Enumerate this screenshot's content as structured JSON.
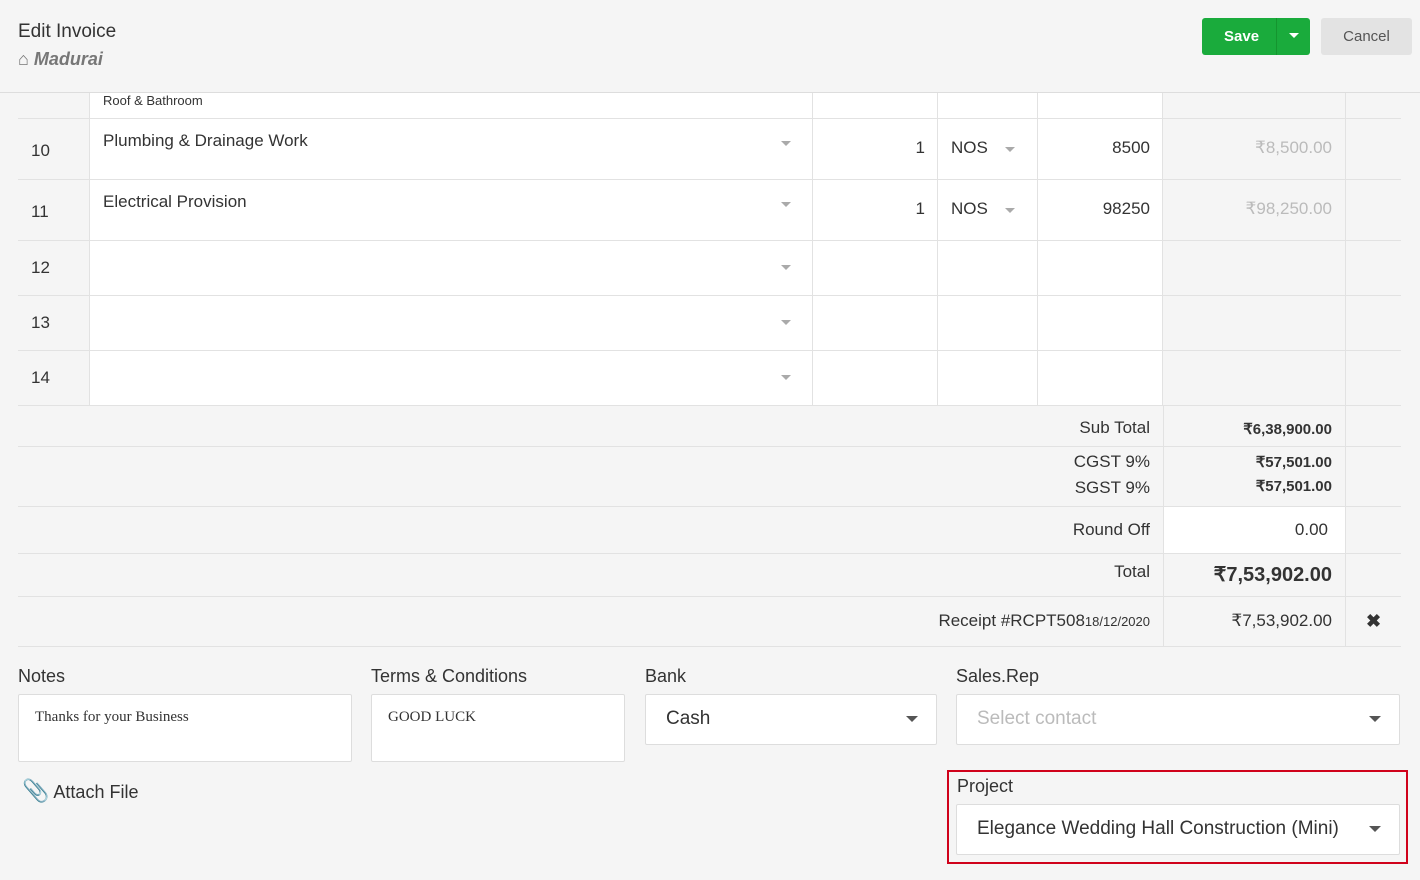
{
  "header": {
    "title": "Edit Invoice",
    "location": "Madurai",
    "save_label": "Save",
    "cancel_label": "Cancel"
  },
  "rows": [
    {
      "num": "",
      "item": "Roof & Bathroom",
      "qty": "",
      "unit": "",
      "rate": "",
      "amount": ""
    },
    {
      "num": "10",
      "item": "Plumbing & Drainage Work",
      "qty": "1",
      "unit": "NOS",
      "rate": "8500",
      "amount": "₹8,500.00"
    },
    {
      "num": "11",
      "item": "Electrical Provision",
      "qty": "1",
      "unit": "NOS",
      "rate": "98250",
      "amount": "₹98,250.00"
    },
    {
      "num": "12",
      "item": "",
      "qty": "",
      "unit": "",
      "rate": "",
      "amount": ""
    },
    {
      "num": "13",
      "item": "",
      "qty": "",
      "unit": "",
      "rate": "",
      "amount": ""
    },
    {
      "num": "14",
      "item": "",
      "qty": "",
      "unit": "",
      "rate": "",
      "amount": ""
    }
  ],
  "totals": {
    "sub_total_label": "Sub Total",
    "sub_total": "₹6,38,900.00",
    "cgst_label": "CGST 9%",
    "cgst": "₹57,501.00",
    "sgst_label": "SGST 9%",
    "sgst": "₹57,501.00",
    "round_off_label": "Round Off",
    "round_off": "0.00",
    "total_label": "Total",
    "total": "₹7,53,902.00",
    "receipt_label": "Receipt #RCPT508",
    "receipt_date": "18/12/2020",
    "receipt_amount": "₹7,53,902.00"
  },
  "footer": {
    "notes_label": "Notes",
    "notes": "Thanks for your Business",
    "terms_label": "Terms & Conditions",
    "terms": "GOOD LUCK",
    "bank_label": "Bank",
    "bank": "Cash",
    "salesrep_label": "Sales.Rep",
    "salesrep_placeholder": "Select contact",
    "attach_label": "Attach File",
    "project_label": "Project",
    "project": "Elegance Wedding Hall Construction (Mini)"
  },
  "colors": {
    "save": "#1aab3c",
    "highlight": "#d0021b"
  }
}
